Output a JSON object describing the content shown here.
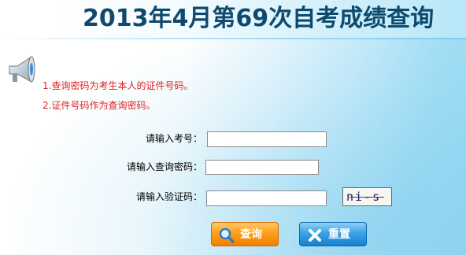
{
  "header": {
    "title": "2013年4月第69次自考成绩查询"
  },
  "notices": {
    "line1": "1.查询密码为考生本人的证件号码。",
    "line2": "2.证件号码作为查询密码。"
  },
  "form": {
    "exam_number_label": "请输入考号：",
    "exam_number_value": "",
    "password_label": "请输入查询密码：",
    "password_value": "",
    "captcha_label": "请输入验证码：",
    "captcha_value": "",
    "captcha_image_text": "ni-s i"
  },
  "buttons": {
    "search_label": "查询",
    "reset_label": "重置"
  },
  "colors": {
    "title": "#0d4a6d",
    "notice": "#e02020",
    "search_button": "#ff9e1a",
    "reset_button": "#3aa3e6"
  },
  "icons": {
    "speaker": "loudspeaker-icon",
    "search": "magnifier-icon",
    "reset": "x-icon"
  }
}
